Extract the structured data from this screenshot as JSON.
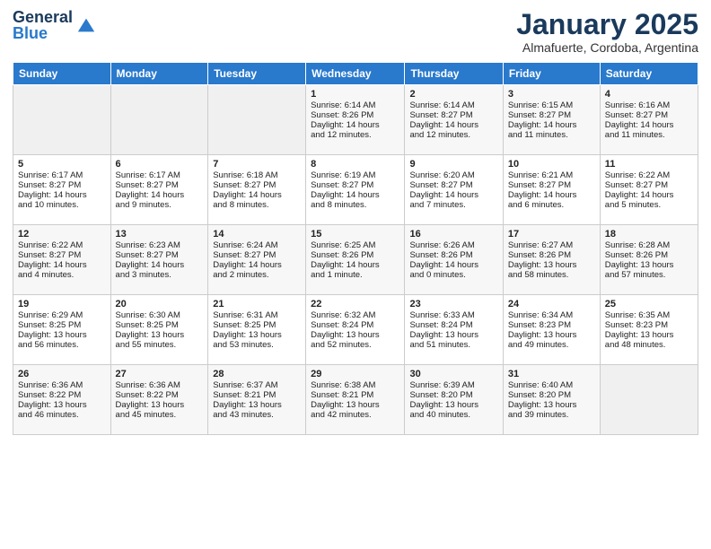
{
  "logo": {
    "general": "General",
    "blue": "Blue"
  },
  "title": "January 2025",
  "subtitle": "Almafuerte, Cordoba, Argentina",
  "weekdays": [
    "Sunday",
    "Monday",
    "Tuesday",
    "Wednesday",
    "Thursday",
    "Friday",
    "Saturday"
  ],
  "weeks": [
    [
      {
        "day": "",
        "info": ""
      },
      {
        "day": "",
        "info": ""
      },
      {
        "day": "",
        "info": ""
      },
      {
        "day": "1",
        "info": "Sunrise: 6:14 AM\nSunset: 8:26 PM\nDaylight: 14 hours\nand 12 minutes."
      },
      {
        "day": "2",
        "info": "Sunrise: 6:14 AM\nSunset: 8:27 PM\nDaylight: 14 hours\nand 12 minutes."
      },
      {
        "day": "3",
        "info": "Sunrise: 6:15 AM\nSunset: 8:27 PM\nDaylight: 14 hours\nand 11 minutes."
      },
      {
        "day": "4",
        "info": "Sunrise: 6:16 AM\nSunset: 8:27 PM\nDaylight: 14 hours\nand 11 minutes."
      }
    ],
    [
      {
        "day": "5",
        "info": "Sunrise: 6:17 AM\nSunset: 8:27 PM\nDaylight: 14 hours\nand 10 minutes."
      },
      {
        "day": "6",
        "info": "Sunrise: 6:17 AM\nSunset: 8:27 PM\nDaylight: 14 hours\nand 9 minutes."
      },
      {
        "day": "7",
        "info": "Sunrise: 6:18 AM\nSunset: 8:27 PM\nDaylight: 14 hours\nand 8 minutes."
      },
      {
        "day": "8",
        "info": "Sunrise: 6:19 AM\nSunset: 8:27 PM\nDaylight: 14 hours\nand 8 minutes."
      },
      {
        "day": "9",
        "info": "Sunrise: 6:20 AM\nSunset: 8:27 PM\nDaylight: 14 hours\nand 7 minutes."
      },
      {
        "day": "10",
        "info": "Sunrise: 6:21 AM\nSunset: 8:27 PM\nDaylight: 14 hours\nand 6 minutes."
      },
      {
        "day": "11",
        "info": "Sunrise: 6:22 AM\nSunset: 8:27 PM\nDaylight: 14 hours\nand 5 minutes."
      }
    ],
    [
      {
        "day": "12",
        "info": "Sunrise: 6:22 AM\nSunset: 8:27 PM\nDaylight: 14 hours\nand 4 minutes."
      },
      {
        "day": "13",
        "info": "Sunrise: 6:23 AM\nSunset: 8:27 PM\nDaylight: 14 hours\nand 3 minutes."
      },
      {
        "day": "14",
        "info": "Sunrise: 6:24 AM\nSunset: 8:27 PM\nDaylight: 14 hours\nand 2 minutes."
      },
      {
        "day": "15",
        "info": "Sunrise: 6:25 AM\nSunset: 8:26 PM\nDaylight: 14 hours\nand 1 minute."
      },
      {
        "day": "16",
        "info": "Sunrise: 6:26 AM\nSunset: 8:26 PM\nDaylight: 14 hours\nand 0 minutes."
      },
      {
        "day": "17",
        "info": "Sunrise: 6:27 AM\nSunset: 8:26 PM\nDaylight: 13 hours\nand 58 minutes."
      },
      {
        "day": "18",
        "info": "Sunrise: 6:28 AM\nSunset: 8:26 PM\nDaylight: 13 hours\nand 57 minutes."
      }
    ],
    [
      {
        "day": "19",
        "info": "Sunrise: 6:29 AM\nSunset: 8:25 PM\nDaylight: 13 hours\nand 56 minutes."
      },
      {
        "day": "20",
        "info": "Sunrise: 6:30 AM\nSunset: 8:25 PM\nDaylight: 13 hours\nand 55 minutes."
      },
      {
        "day": "21",
        "info": "Sunrise: 6:31 AM\nSunset: 8:25 PM\nDaylight: 13 hours\nand 53 minutes."
      },
      {
        "day": "22",
        "info": "Sunrise: 6:32 AM\nSunset: 8:24 PM\nDaylight: 13 hours\nand 52 minutes."
      },
      {
        "day": "23",
        "info": "Sunrise: 6:33 AM\nSunset: 8:24 PM\nDaylight: 13 hours\nand 51 minutes."
      },
      {
        "day": "24",
        "info": "Sunrise: 6:34 AM\nSunset: 8:23 PM\nDaylight: 13 hours\nand 49 minutes."
      },
      {
        "day": "25",
        "info": "Sunrise: 6:35 AM\nSunset: 8:23 PM\nDaylight: 13 hours\nand 48 minutes."
      }
    ],
    [
      {
        "day": "26",
        "info": "Sunrise: 6:36 AM\nSunset: 8:22 PM\nDaylight: 13 hours\nand 46 minutes."
      },
      {
        "day": "27",
        "info": "Sunrise: 6:36 AM\nSunset: 8:22 PM\nDaylight: 13 hours\nand 45 minutes."
      },
      {
        "day": "28",
        "info": "Sunrise: 6:37 AM\nSunset: 8:21 PM\nDaylight: 13 hours\nand 43 minutes."
      },
      {
        "day": "29",
        "info": "Sunrise: 6:38 AM\nSunset: 8:21 PM\nDaylight: 13 hours\nand 42 minutes."
      },
      {
        "day": "30",
        "info": "Sunrise: 6:39 AM\nSunset: 8:20 PM\nDaylight: 13 hours\nand 40 minutes."
      },
      {
        "day": "31",
        "info": "Sunrise: 6:40 AM\nSunset: 8:20 PM\nDaylight: 13 hours\nand 39 minutes."
      },
      {
        "day": "",
        "info": ""
      }
    ]
  ]
}
